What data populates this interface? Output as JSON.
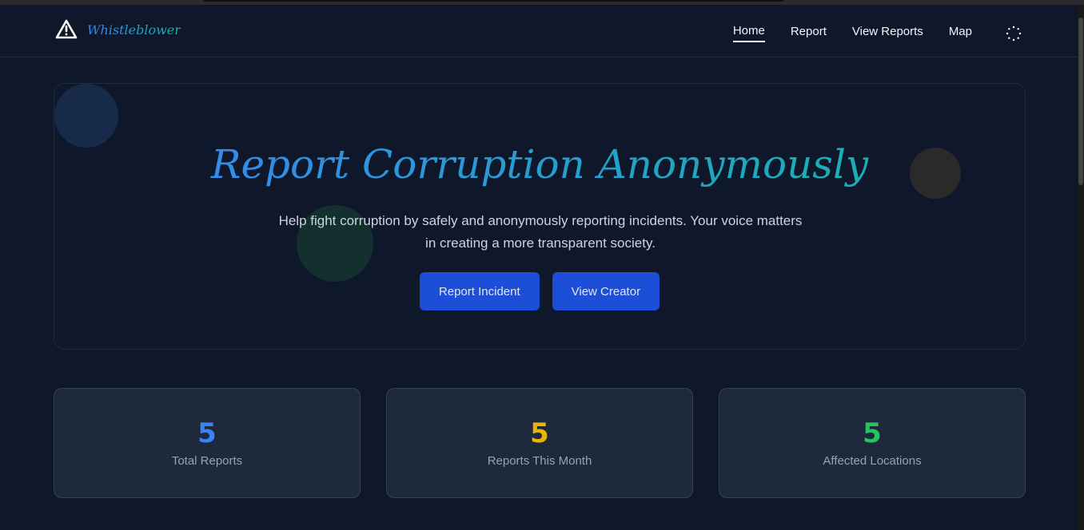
{
  "nav": {
    "brand": "Whistleblower",
    "links": [
      {
        "label": "Home",
        "active": true
      },
      {
        "label": "Report"
      },
      {
        "label": "View Reports"
      },
      {
        "label": "Map"
      }
    ]
  },
  "hero": {
    "title": "Report Corruption Anonymously",
    "subtitle": "Help fight corruption by safely and anonymously reporting incidents. Your voice matters in creating a more transparent society.",
    "primary": "Report Incident",
    "secondary": "View Creator"
  },
  "stats": [
    {
      "value": "5",
      "label": "Total Reports",
      "color": "#3b82f6"
    },
    {
      "value": "5",
      "label": "Reports This Month",
      "color": "#eab308"
    },
    {
      "value": "5",
      "label": "Affected Locations",
      "color": "#22c55e"
    }
  ]
}
